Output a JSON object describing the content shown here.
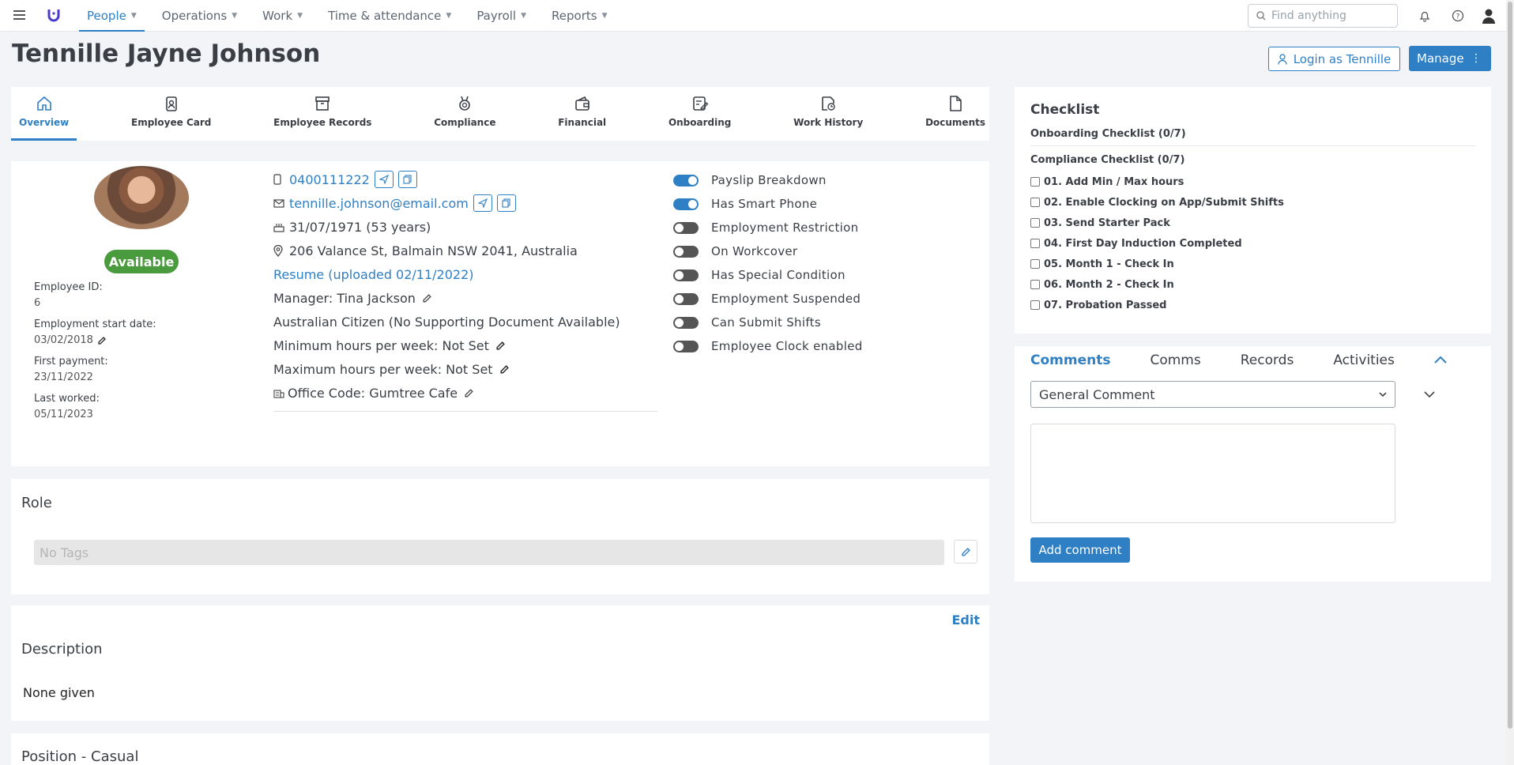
{
  "nav": {
    "items": [
      {
        "label": "People",
        "active": true
      },
      {
        "label": "Operations"
      },
      {
        "label": "Work"
      },
      {
        "label": "Time & attendance"
      },
      {
        "label": "Payroll"
      },
      {
        "label": "Reports"
      }
    ],
    "search_placeholder": "Find anything"
  },
  "header": {
    "title": "Tennille Jayne Johnson",
    "login_label": "Login as Tennille",
    "manage_label": "Manage"
  },
  "tabs": [
    "Overview",
    "Employee Card",
    "Employee Records",
    "Compliance",
    "Financial",
    "Onboarding",
    "Work History",
    "Documents"
  ],
  "profile": {
    "status": "Available",
    "employee_id_label": "Employee ID:",
    "employee_id": "6",
    "start_label": "Employment start date:",
    "start_date": "03/02/2018",
    "first_payment_label": "First payment:",
    "first_payment": "23/11/2022",
    "last_worked_label": "Last worked:",
    "last_worked": "05/11/2023"
  },
  "details": {
    "phone": "0400111222",
    "email": "tennille.johnson@email.com",
    "dob": "31/07/1971 (53 years)",
    "address": "206 Valance St, Balmain NSW 2041, Australia",
    "resume": "Resume (uploaded 02/11/2022)",
    "manager": "Manager: Tina Jackson",
    "citizenship": "Australian Citizen (No Supporting Document Available)",
    "min_hours": "Minimum hours per week: Not Set",
    "max_hours": "Maximum hours per week: Not Set",
    "office": "Office Code: Gumtree Cafe"
  },
  "toggles": [
    {
      "label": "Payslip Breakdown",
      "on": true
    },
    {
      "label": "Has Smart Phone",
      "on": true
    },
    {
      "label": "Employment Restriction",
      "on": false
    },
    {
      "label": "On Workcover",
      "on": false
    },
    {
      "label": "Has Special Condition",
      "on": false
    },
    {
      "label": "Employment Suspended",
      "on": false
    },
    {
      "label": "Can Submit Shifts",
      "on": false
    },
    {
      "label": "Employee Clock enabled",
      "on": false
    }
  ],
  "role": {
    "heading": "Role",
    "tags_placeholder": "No Tags"
  },
  "description": {
    "edit_label": "Edit",
    "heading": "Description",
    "text": "None given"
  },
  "position": {
    "heading": "Position - Casual"
  },
  "checklist": {
    "title": "Checklist",
    "onboarding": "Onboarding Checklist (0/7)",
    "compliance": "Compliance Checklist (0/7)",
    "items": [
      "01. Add Min / Max hours",
      "02. Enable Clocking on App/Submit Shifts",
      "03. Send Starter Pack",
      "04. First Day Induction Completed",
      "05. Month 1 - Check In",
      "06. Month 2 - Check In",
      "07. Probation Passed"
    ]
  },
  "comments": {
    "tabs": [
      "Comments",
      "Comms",
      "Records",
      "Activities"
    ],
    "type_selected": "General Comment",
    "add_label": "Add comment"
  }
}
